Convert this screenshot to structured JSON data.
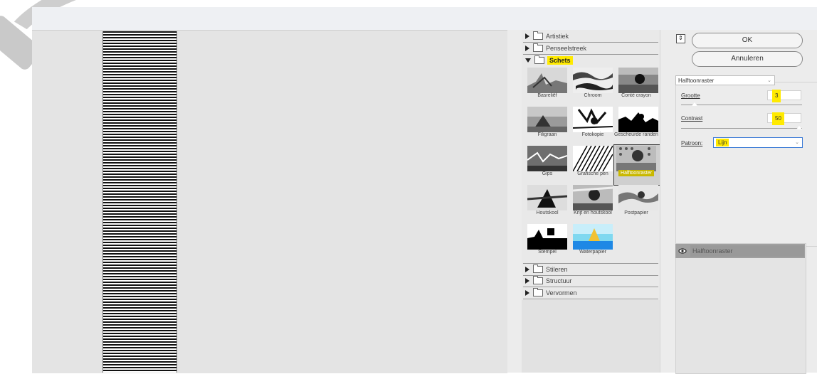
{
  "buttons": {
    "ok": "OK",
    "cancel": "Annuleren",
    "collapse_icon": "collapse-icon"
  },
  "categories": [
    {
      "label": "Artistiek",
      "expanded": false
    },
    {
      "label": "Penseelstreek",
      "expanded": false
    },
    {
      "label": "Schets",
      "expanded": true
    },
    {
      "label": "Stileren",
      "expanded": false
    },
    {
      "label": "Structuur",
      "expanded": false
    },
    {
      "label": "Vervormen",
      "expanded": false
    }
  ],
  "filters": [
    "Basreliëf",
    "Chroom",
    "Conté crayon",
    "Filigraan",
    "Fotokopie",
    "Gescheurde randen",
    "Gips",
    "Grafische pen",
    "Halftoonraster",
    "Houtskool",
    "Krijt en houtskool",
    "Postpapier",
    "Stempel",
    "Waterpapier"
  ],
  "selected_filter": "Halftoonraster",
  "settings": {
    "filter_select": "Halftoonraster",
    "size_label": "Grootte",
    "size_value": "3",
    "size_level": 0.09,
    "contrast_label": "Contrast",
    "contrast_value": "50",
    "contrast_level": 1.0,
    "pattern_label": "Patroon:",
    "pattern_value": "Lijn"
  },
  "layer": {
    "name": "Halftoonraster",
    "icon": "eye-icon"
  },
  "colors": {
    "highlight": "#ffea00",
    "selected_layer": "#a0a0a0"
  }
}
